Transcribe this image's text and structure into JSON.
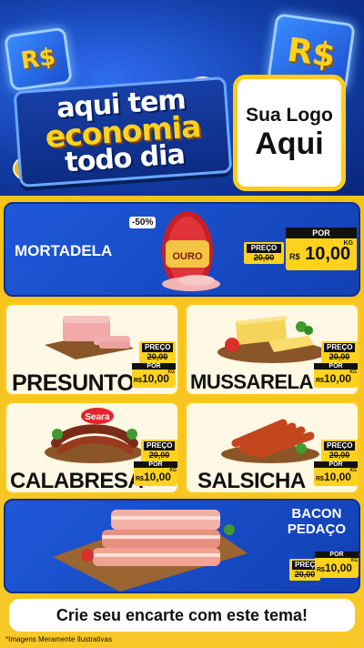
{
  "header": {
    "coin_symbol": "R$",
    "slogan_line1": "aqui tem",
    "slogan_line2": "economia",
    "slogan_line3": "todo dia",
    "logo_line1": "Sua Logo",
    "logo_line2": "Aqui"
  },
  "products": {
    "mortadela": {
      "name": "MORTADELA",
      "badge": "-50%",
      "brand": "OURO",
      "old_label": "PREÇO",
      "old_price": "20,00",
      "new_label": "POR",
      "currency": "R$",
      "new_price": "10,00",
      "unit": "KG"
    },
    "presunto": {
      "name": "PRESUNTO",
      "old_label": "PREÇO",
      "old_price": "20,00",
      "new_label": "POR",
      "currency": "R$",
      "new_price": "10,00",
      "unit": "KG"
    },
    "mussarela": {
      "name": "MUSSARELA",
      "old_label": "PREÇO",
      "old_price": "20,00",
      "new_label": "POR",
      "currency": "R$",
      "new_price": "10,00",
      "unit": "KG"
    },
    "calabresa": {
      "name": "CALABRESA",
      "brand": "Seara",
      "old_label": "PREÇO",
      "old_price": "20,00",
      "new_label": "POR",
      "currency": "R$",
      "new_price": "10,00",
      "unit": "KG"
    },
    "salsicha": {
      "name": "SALSICHA",
      "old_label": "PREÇO",
      "old_price": "20,00",
      "new_label": "POR",
      "currency": "R$",
      "new_price": "10,00",
      "unit": "KG"
    },
    "bacon": {
      "name_line1": "BACON",
      "name_line2": "PEDAÇO",
      "old_label": "PREÇO",
      "old_price": "20,00",
      "new_label": "POR",
      "currency": "R$",
      "new_price": "10,00",
      "unit": "KG"
    }
  },
  "footer": {
    "cta": "Crie seu encarte com este tema!",
    "disclaimer": "*Imagens Meramente Ilustrativas"
  }
}
